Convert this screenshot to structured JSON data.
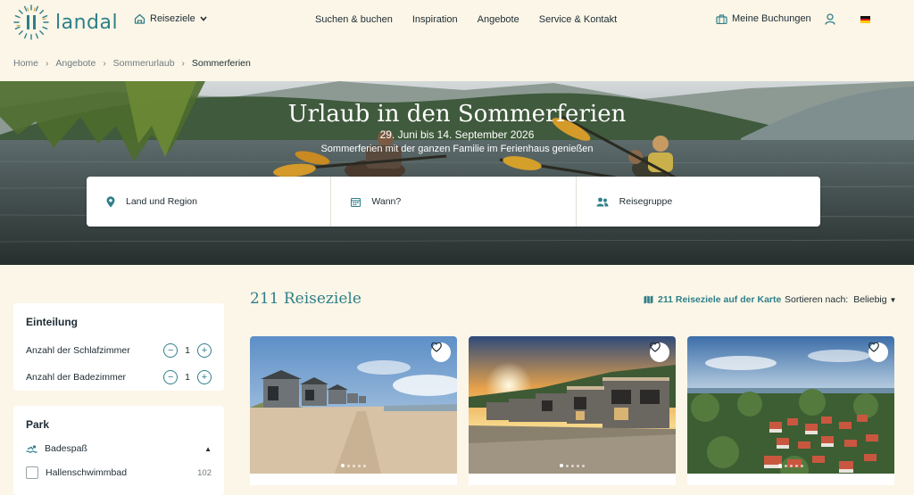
{
  "header": {
    "logo_text": "landal",
    "destinations_label": "Reiseziele",
    "nav": [
      "Suchen & buchen",
      "Inspiration",
      "Angebote",
      "Service & Kontakt"
    ],
    "bookings_label": "Meine Buchungen",
    "language": "de"
  },
  "breadcrumb": [
    "Home",
    "Angebote",
    "Sommerurlaub",
    "Sommerferien"
  ],
  "hero": {
    "title": "Urlaub in den Sommerferien",
    "date": "29. Juni bis 14. September 2026",
    "subtitle": "Sommerferien mit der ganzen Familie im Ferienhaus genießen"
  },
  "search": {
    "region": "Land und Region",
    "when": "Wann?",
    "group": "Reisegruppe"
  },
  "filters": {
    "division": {
      "title": "Einteilung",
      "rows": [
        {
          "label": "Anzahl der Schlafzimmer",
          "value": "1"
        },
        {
          "label": "Anzahl der Badezimmer",
          "value": "1"
        }
      ]
    },
    "park": {
      "title": "Park",
      "section": "Badespaß",
      "items": [
        {
          "label": "Hallenschwimmbad",
          "count": "102"
        }
      ]
    }
  },
  "results": {
    "title": "211 Reiseziele",
    "map_link": "211 Reiseziele auf der Karte",
    "sort_label": "Sortieren nach:",
    "sort_value": "Beliebig"
  },
  "colors": {
    "accent": "#2f7f8a",
    "background": "#fbf6e7",
    "text": "#1d2b33"
  }
}
